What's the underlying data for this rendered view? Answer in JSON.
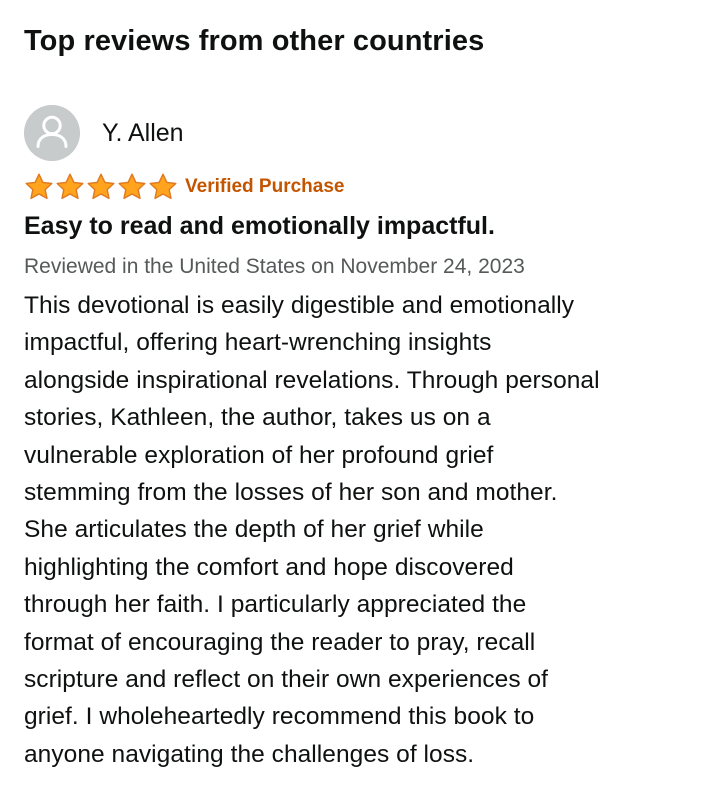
{
  "section": {
    "title": "Top reviews from other countries"
  },
  "review": {
    "reviewer_name": "Y. Allen",
    "avatar_icon": "user-silhouette-icon",
    "rating": 5,
    "rating_max": 5,
    "star_icon": "star-filled-icon",
    "star_color": "#ffa41c",
    "verified_label": "Verified Purchase",
    "verified_color": "#c45500",
    "title": "Easy to read and emotionally impactful.",
    "date_line": "Reviewed in the United States on November 24, 2023",
    "body_lines": [
      "This devotional is easily digestible and emotionally",
      "impactful, offering heart-wrenching insights",
      "alongside inspirational revelations. Through personal",
      "stories, Kathleen, the author, takes us on a",
      "vulnerable exploration of her profound grief",
      "stemming from the losses of her son and mother.",
      "She articulates the depth of her grief while",
      "highlighting the comfort and hope discovered",
      "through her faith. I particularly appreciated the",
      "format of encouraging the reader to pray, recall",
      "scripture and reflect on their own experiences of",
      "grief. I wholeheartedly recommend this book to",
      "anyone navigating the challenges of loss."
    ]
  }
}
